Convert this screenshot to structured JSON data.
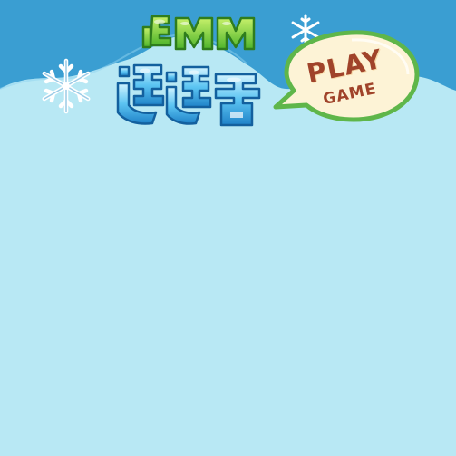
{
  "game": {
    "logo_text": "翻翻连连看",
    "play_button": {
      "line1": "PLAY",
      "line2": "GAME"
    }
  },
  "colors": {
    "background": "#b8e8f4",
    "sky_band": "#3a9ed2",
    "cloud": "#b8e8f4",
    "bubble_fill": "#fdf3d6",
    "bubble_stroke": "#5fb64a",
    "button_text": "#a0432a",
    "logo_green": "#7fd14a",
    "logo_blue": "#3aa8e6"
  },
  "icons": [
    "snowflake-icon",
    "snowflake-icon"
  ]
}
